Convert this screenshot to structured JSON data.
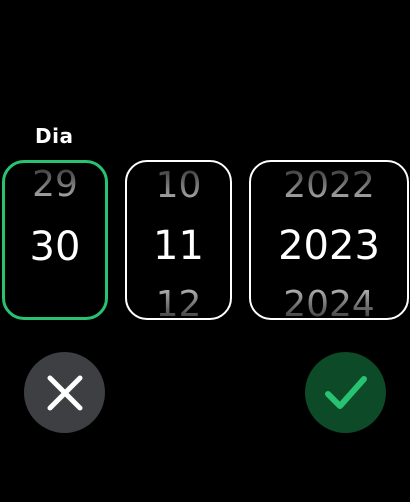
{
  "picker": {
    "day_label": "Dia",
    "day": {
      "prev": "29",
      "current": "30",
      "next": ""
    },
    "month": {
      "prev": "10",
      "current": "11",
      "next": "12"
    },
    "year": {
      "prev": "2022",
      "current": "2023",
      "next": "2024"
    }
  },
  "actions": {
    "cancel_icon": "close-icon",
    "confirm_icon": "check-icon"
  },
  "colors": {
    "background": "#000000",
    "active_border": "#27c372",
    "inactive_border": "#ffffff",
    "cancel_bg": "#3e3f43",
    "confirm_bg": "#0d4a27",
    "confirm_check": "#27c372"
  }
}
